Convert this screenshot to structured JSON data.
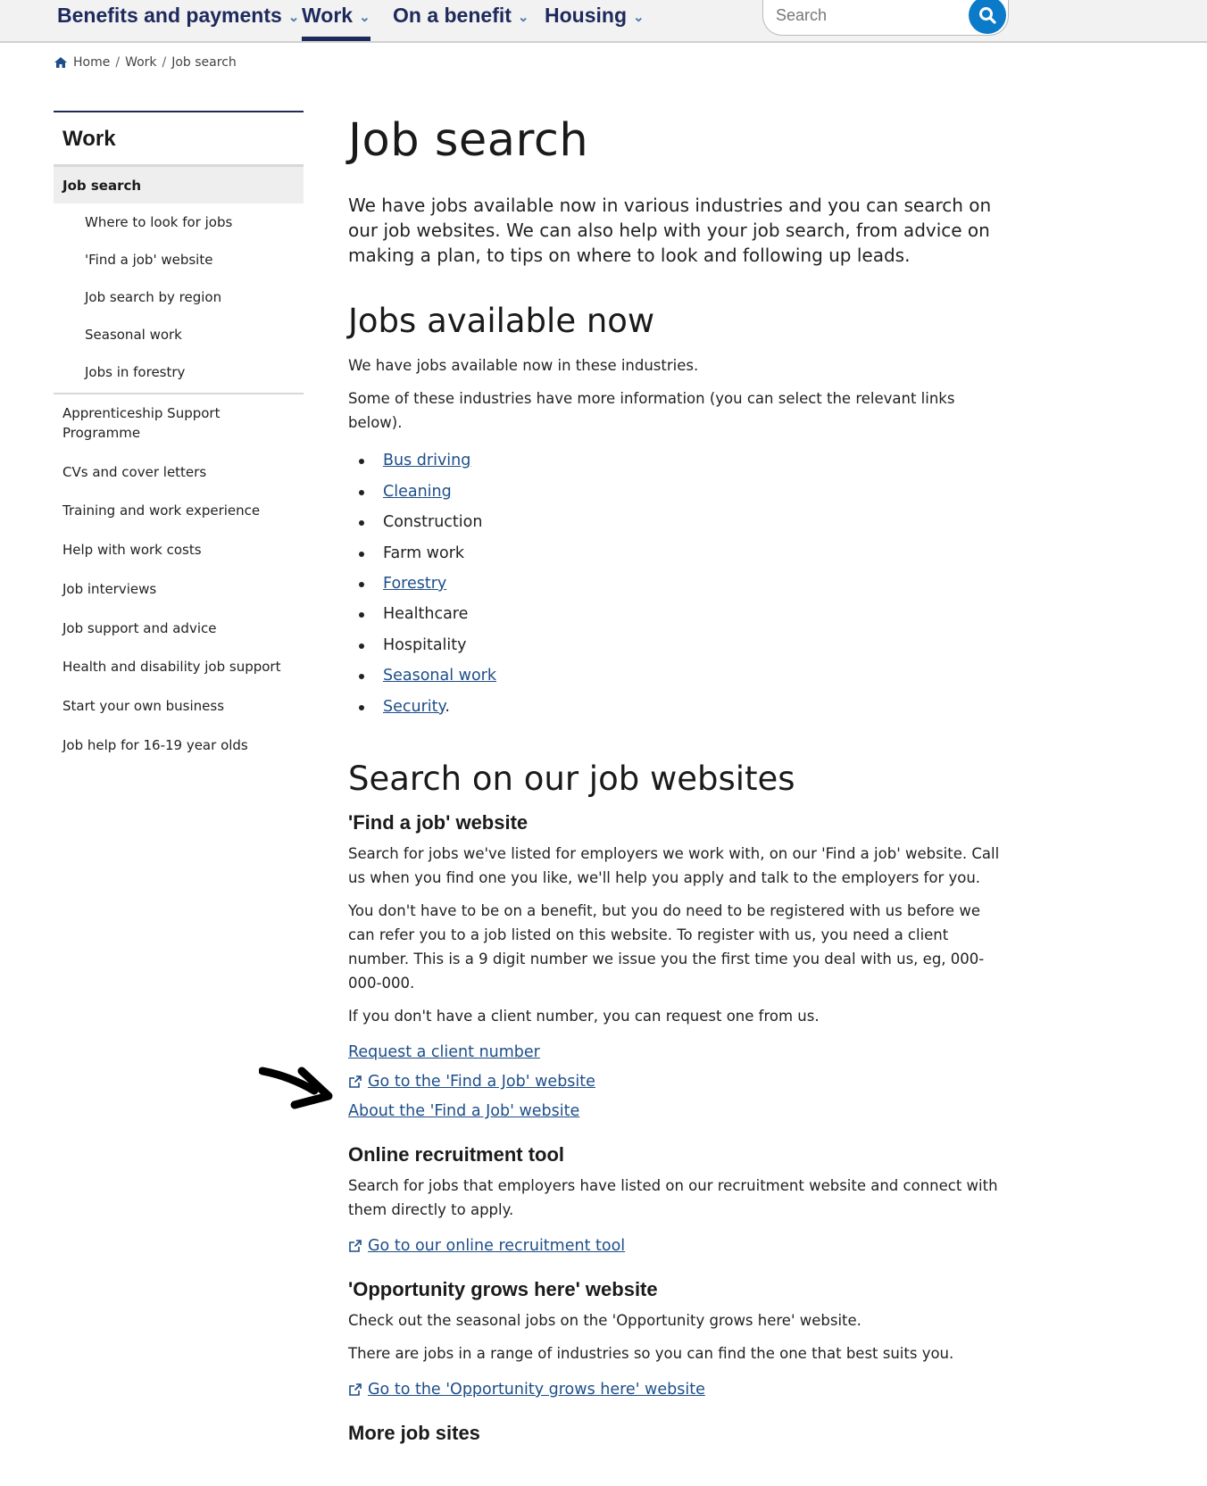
{
  "nav": {
    "items": [
      {
        "label": "Benefits and payments",
        "active": false
      },
      {
        "label": "Work",
        "active": true
      },
      {
        "label": "On a benefit",
        "active": false
      },
      {
        "label": "Housing",
        "active": false
      }
    ],
    "search_placeholder": "Search",
    "search_icon": "magnifier-icon",
    "chevron_icon": "chevron-down-icon"
  },
  "breadcrumb": {
    "home_icon": "home-icon",
    "items": [
      "Home",
      "Work",
      "Job search"
    ],
    "separator": "/"
  },
  "sidebar": {
    "title": "Work",
    "active": "Job search",
    "sub_items": [
      "Where to look for jobs",
      "'Find a job' website",
      "Job search by region",
      "Seasonal work",
      "Jobs in forestry"
    ],
    "items": [
      "Apprenticeship Support Programme",
      "CVs and cover letters",
      "Training and work experience",
      "Help with work costs",
      "Job interviews",
      "Job support and advice",
      "Health and disability job support",
      "Start your own business",
      "Job help for 16-19 year olds"
    ]
  },
  "main": {
    "title": "Job search",
    "lead": "We have jobs available now in various industries and you can search on our job websites. We can also help with your job search, from advice on making a plan, to tips on where to look and following up leads.",
    "jobs_now": {
      "heading": "Jobs available now",
      "p1": "We have jobs available now in these industries.",
      "p2": "Some of these industries have more information (you can select the relevant links below).",
      "industries": [
        {
          "label": "Bus driving",
          "link": true,
          "suffix": ""
        },
        {
          "label": "Cleaning",
          "link": true,
          "suffix": ""
        },
        {
          "label": "Construction",
          "link": false,
          "suffix": ""
        },
        {
          "label": "Farm work",
          "link": false,
          "suffix": ""
        },
        {
          "label": "Forestry",
          "link": true,
          "suffix": ""
        },
        {
          "label": "Healthcare",
          "link": false,
          "suffix": ""
        },
        {
          "label": "Hospitality",
          "link": false,
          "suffix": ""
        },
        {
          "label": "Seasonal work",
          "link": true,
          "suffix": ""
        },
        {
          "label": "Security",
          "link": true,
          "suffix": "."
        }
      ]
    },
    "search_sites": {
      "heading": "Search on our job websites",
      "find_job": {
        "heading": "'Find a job' website",
        "p1": "Search for jobs we've listed for employers we work with, on our 'Find a job' website. Call us when you find one you like, we'll help you apply and talk to the employers for you.",
        "p2": "You don't have to be on a benefit, but you do need to be registered with us before we can refer you to a job listed on this website. To register with us, you need a client number. This is a 9 digit number we issue you the first time you deal with us, eg, 000-000-000.",
        "p3": "If you don't have a client number, you can request one from us.",
        "link_request": "Request a client number",
        "link_go": "Go to the 'Find a Job' website",
        "link_about": "About the 'Find a Job' website"
      },
      "recruitment": {
        "heading": "Online recruitment tool",
        "p1": "Search for jobs that employers have listed on our recruitment website and connect with them directly to apply.",
        "link": "Go to our online recruitment tool"
      },
      "opportunity": {
        "heading": "'Opportunity grows here' website",
        "p1": "Check out the seasonal jobs on the 'Opportunity grows here' website.",
        "p2": "There are jobs in a range of industries so you can find the one that best suits you.",
        "link": "Go to the 'Opportunity grows here' website"
      },
      "more": {
        "heading": "More job sites"
      }
    }
  },
  "colors": {
    "navy": "#1d2a5c",
    "link": "#1d4e89",
    "search_button": "#0a7ac9"
  }
}
